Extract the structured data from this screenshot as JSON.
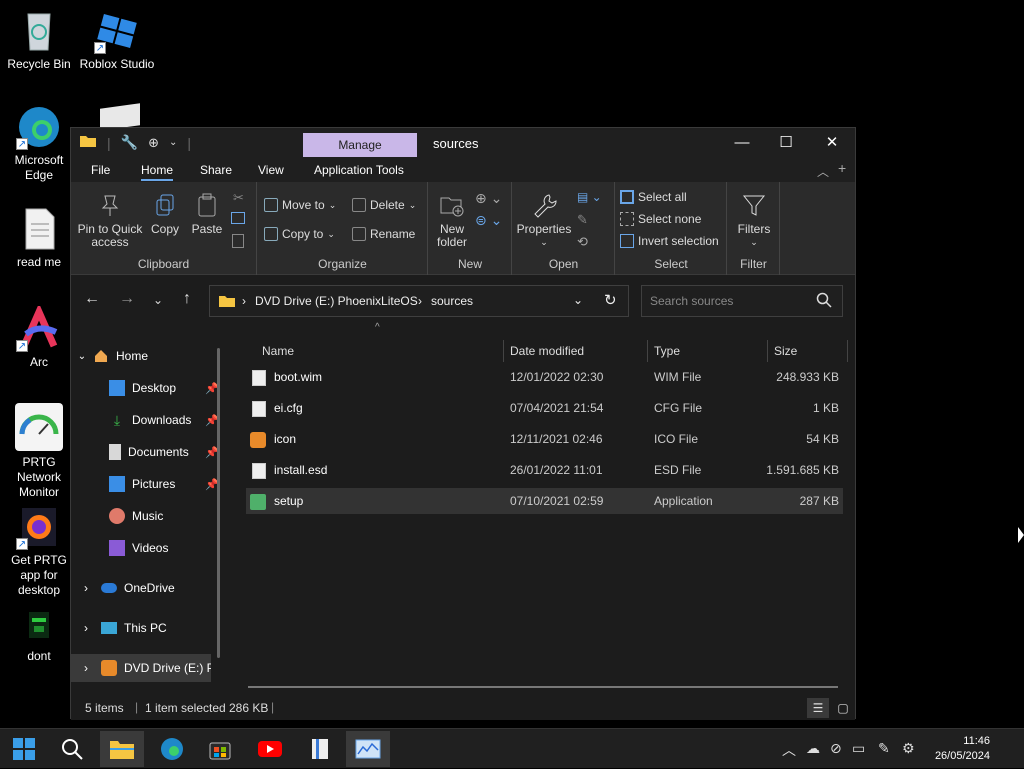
{
  "desktop": {
    "icons": [
      {
        "label": "Recycle Bin",
        "icon": "recycle-bin-icon"
      },
      {
        "label": "Roblox Studio",
        "icon": "roblox-studio-icon"
      },
      {
        "label": "Microsoft Edge",
        "icon": "edge-icon"
      },
      {
        "label": "read me",
        "icon": "text-file-icon"
      },
      {
        "label": "Arc",
        "icon": "arc-icon"
      },
      {
        "label": "PRTG Network Monitor",
        "icon": "prtg-icon"
      },
      {
        "label": "Get PRTG app for desktop",
        "icon": "firefox-icon"
      },
      {
        "label": "dont",
        "icon": "app-icon"
      }
    ]
  },
  "window": {
    "manage_tab": "Manage",
    "title": "sources",
    "menu": [
      "File",
      "Home",
      "Share",
      "View",
      "Application Tools"
    ],
    "active_menu": "Home",
    "ribbon": {
      "clipboard": {
        "label": "Clipboard",
        "pin": "Pin to Quick access",
        "copy": "Copy",
        "paste": "Paste"
      },
      "organize": {
        "label": "Organize",
        "move_to": "Move to",
        "copy_to": "Copy to",
        "delete": "Delete",
        "rename": "Rename"
      },
      "new": {
        "label": "New",
        "new_folder": "New folder"
      },
      "open": {
        "label": "Open",
        "properties": "Properties"
      },
      "select": {
        "label": "Select",
        "select_all": "Select all",
        "select_none": "Select none",
        "invert": "Invert selection"
      },
      "filter": {
        "label": "Filter",
        "filters": "Filters"
      }
    },
    "address": {
      "segments": [
        "DVD Drive (E:) PhoenixLiteOS",
        "sources"
      ]
    },
    "search_placeholder": "Search sources",
    "tree": [
      {
        "label": "Home",
        "level": 0,
        "expanded": true
      },
      {
        "label": "Desktop",
        "level": 1,
        "pinned": true
      },
      {
        "label": "Downloads",
        "level": 1,
        "pinned": true
      },
      {
        "label": "Documents",
        "level": 1,
        "pinned": true
      },
      {
        "label": "Pictures",
        "level": 1,
        "pinned": true
      },
      {
        "label": "Music",
        "level": 1
      },
      {
        "label": "Videos",
        "level": 1
      },
      {
        "label": "OneDrive",
        "level": 0
      },
      {
        "label": "This PC",
        "level": 0
      },
      {
        "label": "DVD Drive (E:) Ph",
        "level": 0,
        "selected": true
      }
    ],
    "columns": [
      "Name",
      "Date modified",
      "Type",
      "Size"
    ],
    "files": [
      {
        "name": "boot.wim",
        "date": "12/01/2022 02:30",
        "type": "WIM File",
        "size": "248.933 KB",
        "icon": "file-icon"
      },
      {
        "name": "ei.cfg",
        "date": "07/04/2021 21:54",
        "type": "CFG File",
        "size": "1 KB",
        "icon": "file-icon"
      },
      {
        "name": "icon",
        "date": "12/11/2021 02:46",
        "type": "ICO File",
        "size": "54 KB",
        "icon": "phoenix-icon"
      },
      {
        "name": "install.esd",
        "date": "26/01/2022 11:01",
        "type": "ESD File",
        "size": "1.591.685 KB",
        "icon": "file-icon"
      },
      {
        "name": "setup",
        "date": "07/10/2021 02:59",
        "type": "Application",
        "size": "287 KB",
        "icon": "setup-app-icon",
        "selected": true
      }
    ],
    "status": {
      "items": "5 items",
      "selected": "1 item selected",
      "size": "286 KB"
    }
  },
  "taskbar": {
    "time": "11:46",
    "date": "26/05/2024"
  },
  "colors": {
    "accent": "#6aa6e8",
    "manage_tab": "#c9b7e8",
    "selected_row": "#333333"
  }
}
